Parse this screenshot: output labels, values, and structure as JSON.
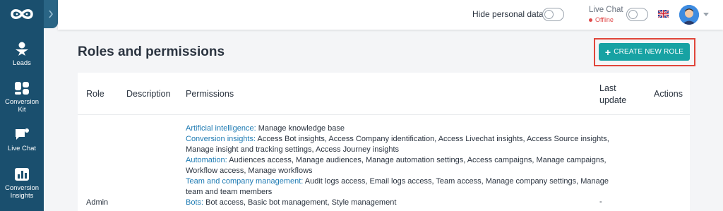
{
  "sidebar": {
    "items": [
      {
        "label": "Leads",
        "icon": "star-person-icon"
      },
      {
        "label": "Conversion Kit",
        "icon": "conversion-kit-icon"
      },
      {
        "label": "Live Chat",
        "icon": "chat-bubble-icon"
      },
      {
        "label": "Conversion Insights",
        "icon": "bar-chart-icon"
      }
    ]
  },
  "topbar": {
    "hide_personal_data_label": "Hide personal data",
    "live_chat_label": "Live Chat",
    "live_chat_status": "Offline"
  },
  "page": {
    "title": "Roles and permissions",
    "create_button_label": "CREATE NEW ROLE"
  },
  "table": {
    "headers": {
      "role": "Role",
      "description": "Description",
      "permissions": "Permissions",
      "last_update_line1": "Last",
      "last_update_line2": "update",
      "actions": "Actions"
    },
    "rows": [
      {
        "role": "Admin",
        "last_update": "-",
        "permissions": [
          {
            "category": "Artificial intelligence:",
            "text": " Manage knowledge base"
          },
          {
            "category": "Conversion insights:",
            "text": " Access Bot insights, Access Company identification, Access Livechat insights, Access Source insights,"
          },
          {
            "category": "",
            "text": "Manage insight and tracking settings, Access Journey insights"
          },
          {
            "category": "Automation:",
            "text": " Audiences access, Manage audiences, Manage automation settings, Access campaigns, Manage campaigns,"
          },
          {
            "category": "",
            "text": "Workflow access, Manage workflows"
          },
          {
            "category": "Team and company management:",
            "text": " Audit logs access, Email logs access, Team access, Manage company settings, Manage"
          },
          {
            "category": "",
            "text": "team and team members"
          },
          {
            "category": "Bots:",
            "text": " Bot access, Basic bot management, Style management"
          }
        ]
      }
    ]
  },
  "colors": {
    "sidebar": "#1a4f6e",
    "accent": "#17a2a3",
    "link": "#1f7bb3",
    "offline": "#e04b4b",
    "highlight": "#e0453a"
  }
}
